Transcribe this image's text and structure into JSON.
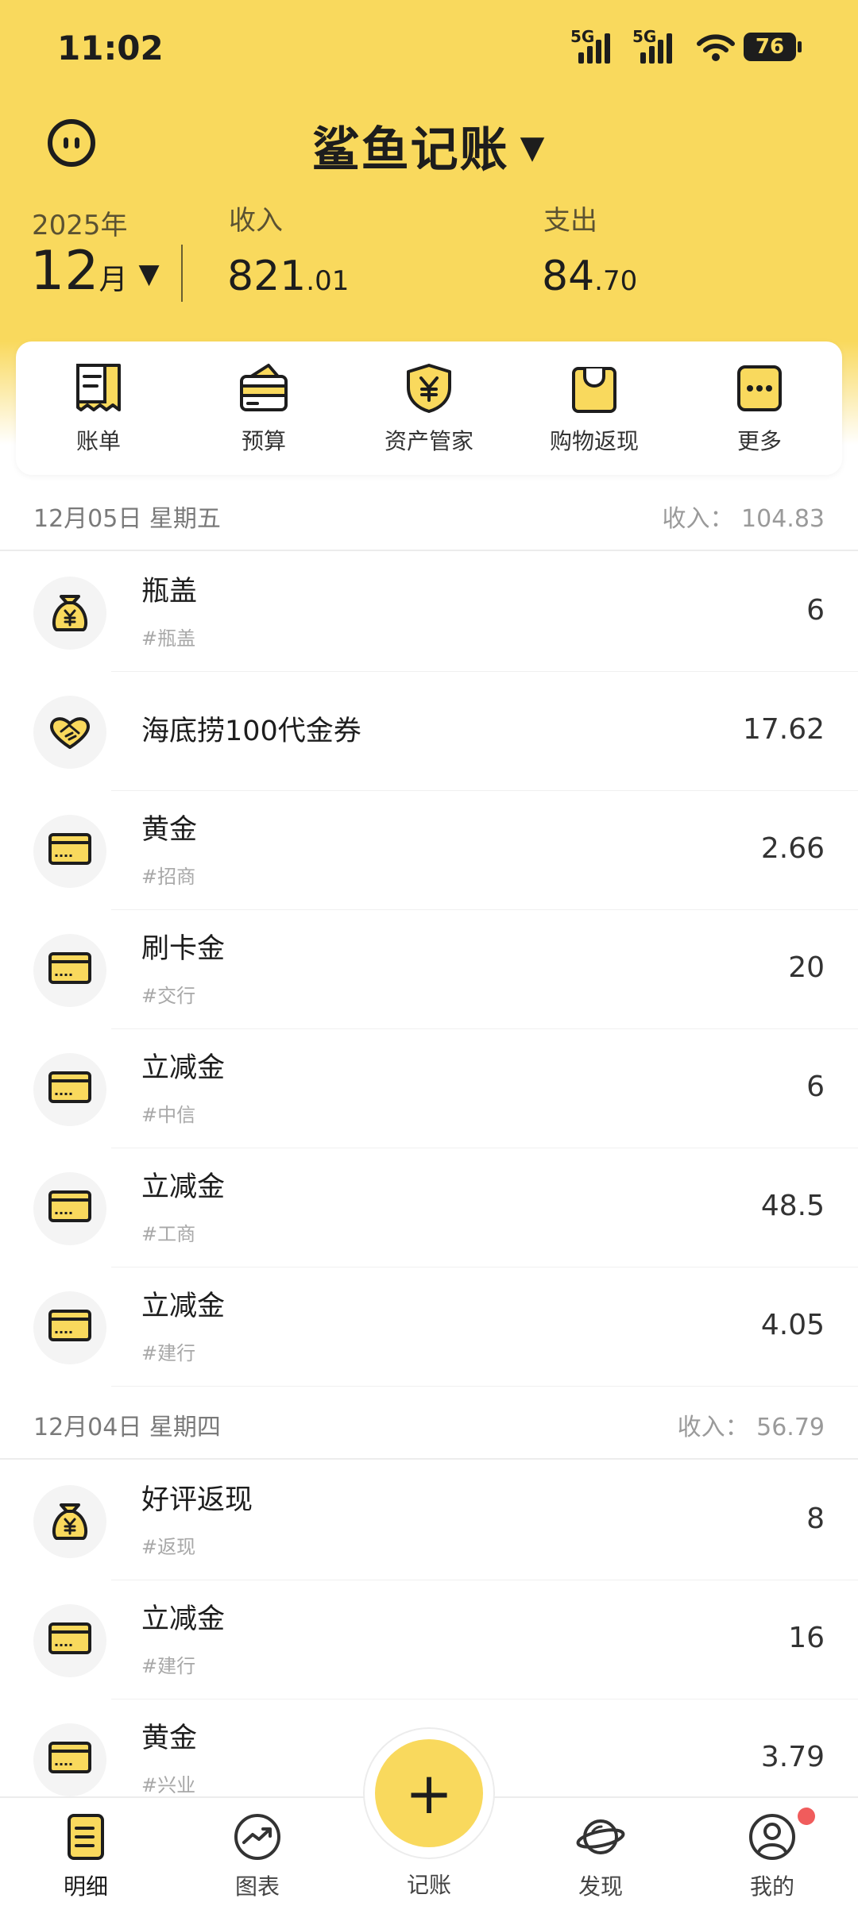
{
  "status": {
    "time": "11:02",
    "network1": "5G",
    "network2": "5G",
    "battery": "76"
  },
  "header": {
    "app_title": "鲨鱼记账",
    "year": "2025年",
    "month": "12",
    "month_unit": "月",
    "income_label": "收入",
    "income_int": "821",
    "income_dec": ".01",
    "expense_label": "支出",
    "expense_int": "84",
    "expense_dec": ".70"
  },
  "quick_actions": [
    {
      "label": "账单",
      "icon": "bill-icon"
    },
    {
      "label": "预算",
      "icon": "wallet-icon"
    },
    {
      "label": "资产管家",
      "icon": "shield-yuan-icon"
    },
    {
      "label": "购物返现",
      "icon": "shopping-bag-icon"
    },
    {
      "label": "更多",
      "icon": "more-icon"
    }
  ],
  "days": [
    {
      "date": "12月05日 星期五",
      "summary": "收入： 104.83",
      "items": [
        {
          "name": "瓶盖",
          "tag": "#瓶盖",
          "amount": "6",
          "icon": "money-bag-icon"
        },
        {
          "name": "海底捞100代金券",
          "tag": "",
          "amount": "17.62",
          "icon": "handshake-icon"
        },
        {
          "name": "黄金",
          "tag": "#招商",
          "amount": "2.66",
          "icon": "card-icon"
        },
        {
          "name": "刷卡金",
          "tag": "#交行",
          "amount": "20",
          "icon": "card-icon"
        },
        {
          "name": "立减金",
          "tag": "#中信",
          "amount": "6",
          "icon": "card-icon"
        },
        {
          "name": "立减金",
          "tag": "#工商",
          "amount": "48.5",
          "icon": "card-icon"
        },
        {
          "name": "立减金",
          "tag": "#建行",
          "amount": "4.05",
          "icon": "card-icon"
        }
      ]
    },
    {
      "date": "12月04日 星期四",
      "summary": "收入： 56.79",
      "items": [
        {
          "name": "好评返现",
          "tag": "#返现",
          "amount": "8",
          "icon": "money-bag-icon"
        },
        {
          "name": "立减金",
          "tag": "#建行",
          "amount": "16",
          "icon": "card-icon"
        },
        {
          "name": "黄金",
          "tag": "#兴业",
          "amount": "3.79",
          "icon": "card-icon"
        }
      ]
    }
  ],
  "tabbar": {
    "tabs": [
      "明细",
      "图表",
      "记账",
      "发现",
      "我的"
    ]
  },
  "colors": {
    "accent": "#f9d95d",
    "text": "#1d1d1d",
    "badge": "#f05c5c"
  }
}
